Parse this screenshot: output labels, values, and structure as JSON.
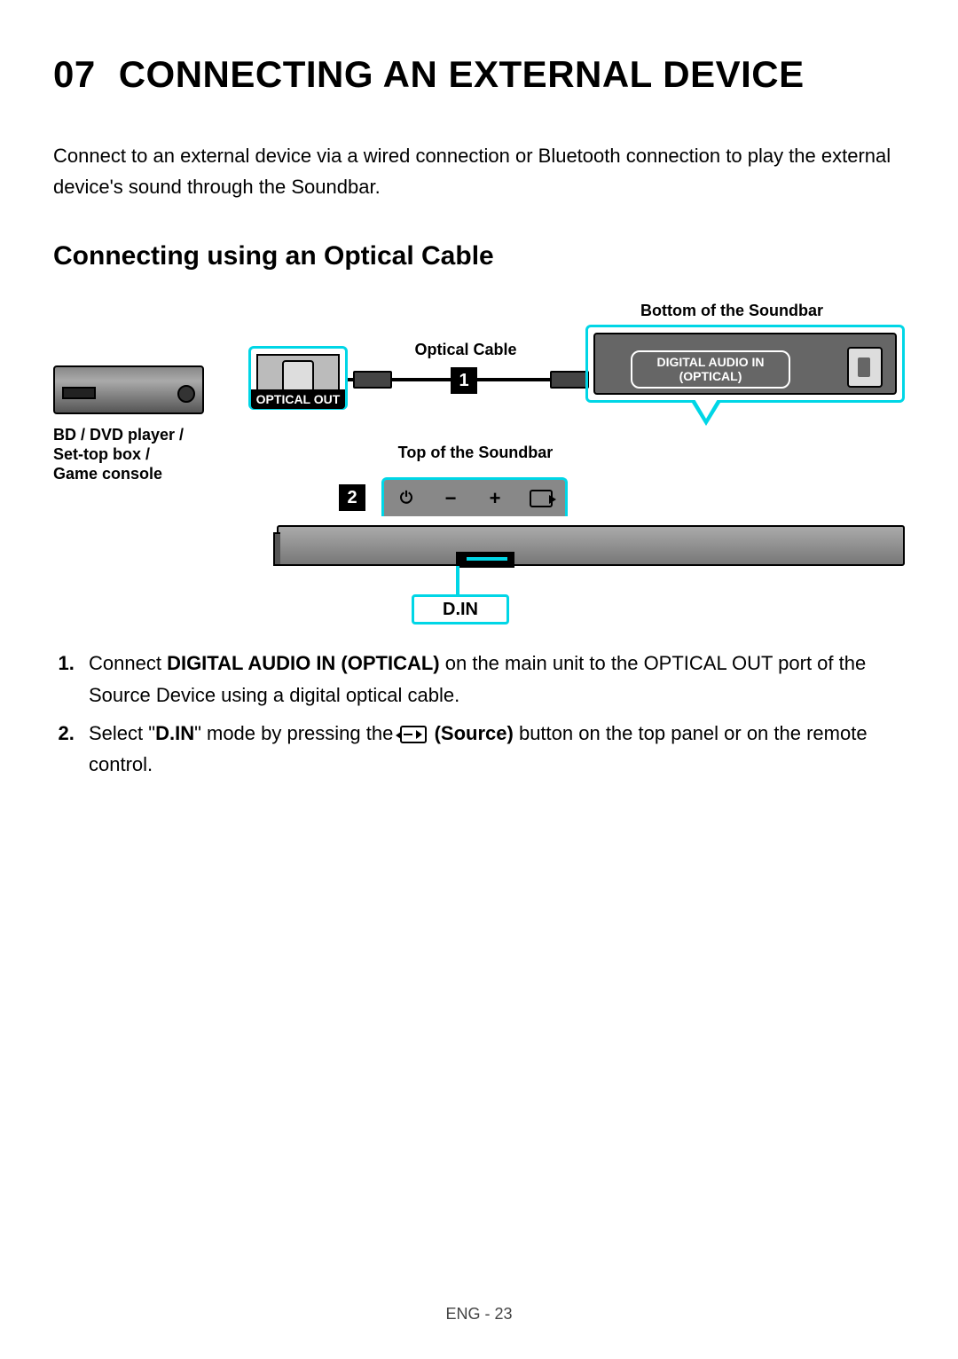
{
  "chapter": {
    "num": "07",
    "title": "CONNECTING AN EXTERNAL DEVICE"
  },
  "intro": "Connect to an external device via a wired connection or Bluetooth connection to play the external device's sound through the Soundbar.",
  "section_title": "Connecting using an Optical Cable",
  "diagram": {
    "bottom_caption": "Bottom of the Soundbar",
    "optical_cable_caption": "Optical Cable",
    "optical_out_label": "OPTICAL OUT",
    "digital_audio_in_line1": "DIGITAL AUDIO IN",
    "digital_audio_in_line2": "(OPTICAL)",
    "source_device_label": "BD / DVD player /\nSet-top box /\nGame console",
    "top_caption": "Top of the Soundbar",
    "din_label": "D.IN",
    "step1_badge": "1",
    "step2_badge": "2"
  },
  "steps": {
    "s1_pre": "Connect ",
    "s1_bold": "DIGITAL AUDIO IN (OPTICAL)",
    "s1_post": " on the main unit to the OPTICAL OUT port of the Source Device using a digital optical cable.",
    "s2_pre": "Select \"",
    "s2_bold1": "D.IN",
    "s2_mid": "\" mode by pressing the ",
    "s2_bold2": "(Source)",
    "s2_post": " button on the top panel or on the remote control."
  },
  "footer": "ENG - 23"
}
